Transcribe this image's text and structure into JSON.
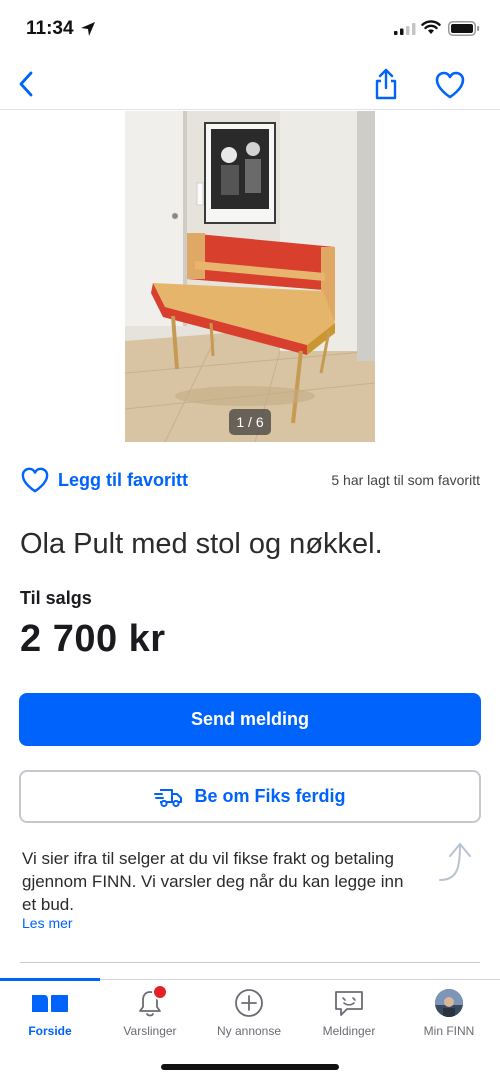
{
  "status_bar": {
    "time": "11:34"
  },
  "image": {
    "counter": "1 / 6"
  },
  "favorite": {
    "label": "Legg til favoritt",
    "count_text": "5 har lagt til som favoritt"
  },
  "listing": {
    "title": "Ola Pult med stol og nøkkel.",
    "type": "Til salgs",
    "price": "2 700 kr"
  },
  "actions": {
    "primary_label": "Send melding",
    "secondary_label": "Be om Fiks ferdig"
  },
  "info": {
    "text": "Vi sier ifra til selger at du vil fikse frakt og betaling gjennom FINN. Vi varsler deg når du kan legge inn et bud.",
    "read_more": "Les mer"
  },
  "tabs": [
    {
      "label": "Forside",
      "icon": "home-icon",
      "active": true
    },
    {
      "label": "Varslinger",
      "icon": "bell-icon",
      "badge": true
    },
    {
      "label": "Ny annonse",
      "icon": "plus-circle-icon"
    },
    {
      "label": "Meldinger",
      "icon": "chat-icon"
    },
    {
      "label": "Min FINN",
      "icon": "avatar"
    }
  ],
  "colors": {
    "accent": "#0063fb",
    "badge": "#e5202a"
  }
}
